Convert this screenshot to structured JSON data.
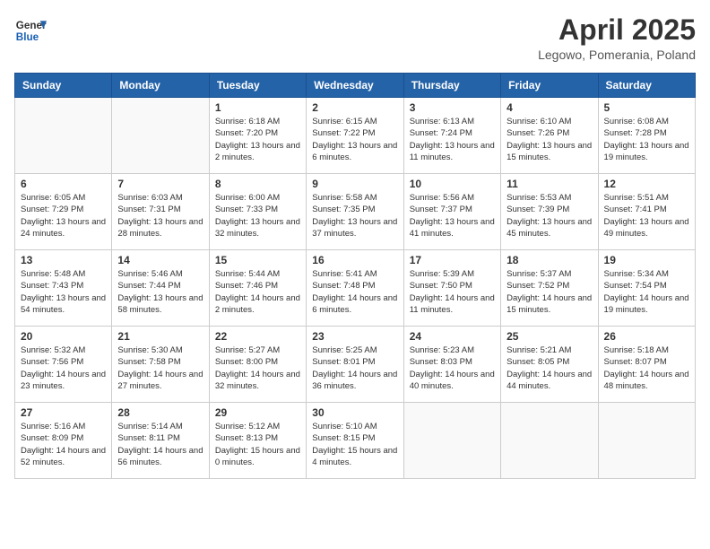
{
  "header": {
    "logo_general": "General",
    "logo_blue": "Blue",
    "month_title": "April 2025",
    "location": "Legowo, Pomerania, Poland"
  },
  "days_of_week": [
    "Sunday",
    "Monday",
    "Tuesday",
    "Wednesday",
    "Thursday",
    "Friday",
    "Saturday"
  ],
  "weeks": [
    [
      {
        "day": "",
        "content": ""
      },
      {
        "day": "",
        "content": ""
      },
      {
        "day": "1",
        "content": "Sunrise: 6:18 AM\nSunset: 7:20 PM\nDaylight: 13 hours\nand 2 minutes."
      },
      {
        "day": "2",
        "content": "Sunrise: 6:15 AM\nSunset: 7:22 PM\nDaylight: 13 hours\nand 6 minutes."
      },
      {
        "day": "3",
        "content": "Sunrise: 6:13 AM\nSunset: 7:24 PM\nDaylight: 13 hours\nand 11 minutes."
      },
      {
        "day": "4",
        "content": "Sunrise: 6:10 AM\nSunset: 7:26 PM\nDaylight: 13 hours\nand 15 minutes."
      },
      {
        "day": "5",
        "content": "Sunrise: 6:08 AM\nSunset: 7:28 PM\nDaylight: 13 hours\nand 19 minutes."
      }
    ],
    [
      {
        "day": "6",
        "content": "Sunrise: 6:05 AM\nSunset: 7:29 PM\nDaylight: 13 hours\nand 24 minutes."
      },
      {
        "day": "7",
        "content": "Sunrise: 6:03 AM\nSunset: 7:31 PM\nDaylight: 13 hours\nand 28 minutes."
      },
      {
        "day": "8",
        "content": "Sunrise: 6:00 AM\nSunset: 7:33 PM\nDaylight: 13 hours\nand 32 minutes."
      },
      {
        "day": "9",
        "content": "Sunrise: 5:58 AM\nSunset: 7:35 PM\nDaylight: 13 hours\nand 37 minutes."
      },
      {
        "day": "10",
        "content": "Sunrise: 5:56 AM\nSunset: 7:37 PM\nDaylight: 13 hours\nand 41 minutes."
      },
      {
        "day": "11",
        "content": "Sunrise: 5:53 AM\nSunset: 7:39 PM\nDaylight: 13 hours\nand 45 minutes."
      },
      {
        "day": "12",
        "content": "Sunrise: 5:51 AM\nSunset: 7:41 PM\nDaylight: 13 hours\nand 49 minutes."
      }
    ],
    [
      {
        "day": "13",
        "content": "Sunrise: 5:48 AM\nSunset: 7:43 PM\nDaylight: 13 hours\nand 54 minutes."
      },
      {
        "day": "14",
        "content": "Sunrise: 5:46 AM\nSunset: 7:44 PM\nDaylight: 13 hours\nand 58 minutes."
      },
      {
        "day": "15",
        "content": "Sunrise: 5:44 AM\nSunset: 7:46 PM\nDaylight: 14 hours\nand 2 minutes."
      },
      {
        "day": "16",
        "content": "Sunrise: 5:41 AM\nSunset: 7:48 PM\nDaylight: 14 hours\nand 6 minutes."
      },
      {
        "day": "17",
        "content": "Sunrise: 5:39 AM\nSunset: 7:50 PM\nDaylight: 14 hours\nand 11 minutes."
      },
      {
        "day": "18",
        "content": "Sunrise: 5:37 AM\nSunset: 7:52 PM\nDaylight: 14 hours\nand 15 minutes."
      },
      {
        "day": "19",
        "content": "Sunrise: 5:34 AM\nSunset: 7:54 PM\nDaylight: 14 hours\nand 19 minutes."
      }
    ],
    [
      {
        "day": "20",
        "content": "Sunrise: 5:32 AM\nSunset: 7:56 PM\nDaylight: 14 hours\nand 23 minutes."
      },
      {
        "day": "21",
        "content": "Sunrise: 5:30 AM\nSunset: 7:58 PM\nDaylight: 14 hours\nand 27 minutes."
      },
      {
        "day": "22",
        "content": "Sunrise: 5:27 AM\nSunset: 8:00 PM\nDaylight: 14 hours\nand 32 minutes."
      },
      {
        "day": "23",
        "content": "Sunrise: 5:25 AM\nSunset: 8:01 PM\nDaylight: 14 hours\nand 36 minutes."
      },
      {
        "day": "24",
        "content": "Sunrise: 5:23 AM\nSunset: 8:03 PM\nDaylight: 14 hours\nand 40 minutes."
      },
      {
        "day": "25",
        "content": "Sunrise: 5:21 AM\nSunset: 8:05 PM\nDaylight: 14 hours\nand 44 minutes."
      },
      {
        "day": "26",
        "content": "Sunrise: 5:18 AM\nSunset: 8:07 PM\nDaylight: 14 hours\nand 48 minutes."
      }
    ],
    [
      {
        "day": "27",
        "content": "Sunrise: 5:16 AM\nSunset: 8:09 PM\nDaylight: 14 hours\nand 52 minutes."
      },
      {
        "day": "28",
        "content": "Sunrise: 5:14 AM\nSunset: 8:11 PM\nDaylight: 14 hours\nand 56 minutes."
      },
      {
        "day": "29",
        "content": "Sunrise: 5:12 AM\nSunset: 8:13 PM\nDaylight: 15 hours\nand 0 minutes."
      },
      {
        "day": "30",
        "content": "Sunrise: 5:10 AM\nSunset: 8:15 PM\nDaylight: 15 hours\nand 4 minutes."
      },
      {
        "day": "",
        "content": ""
      },
      {
        "day": "",
        "content": ""
      },
      {
        "day": "",
        "content": ""
      }
    ]
  ]
}
